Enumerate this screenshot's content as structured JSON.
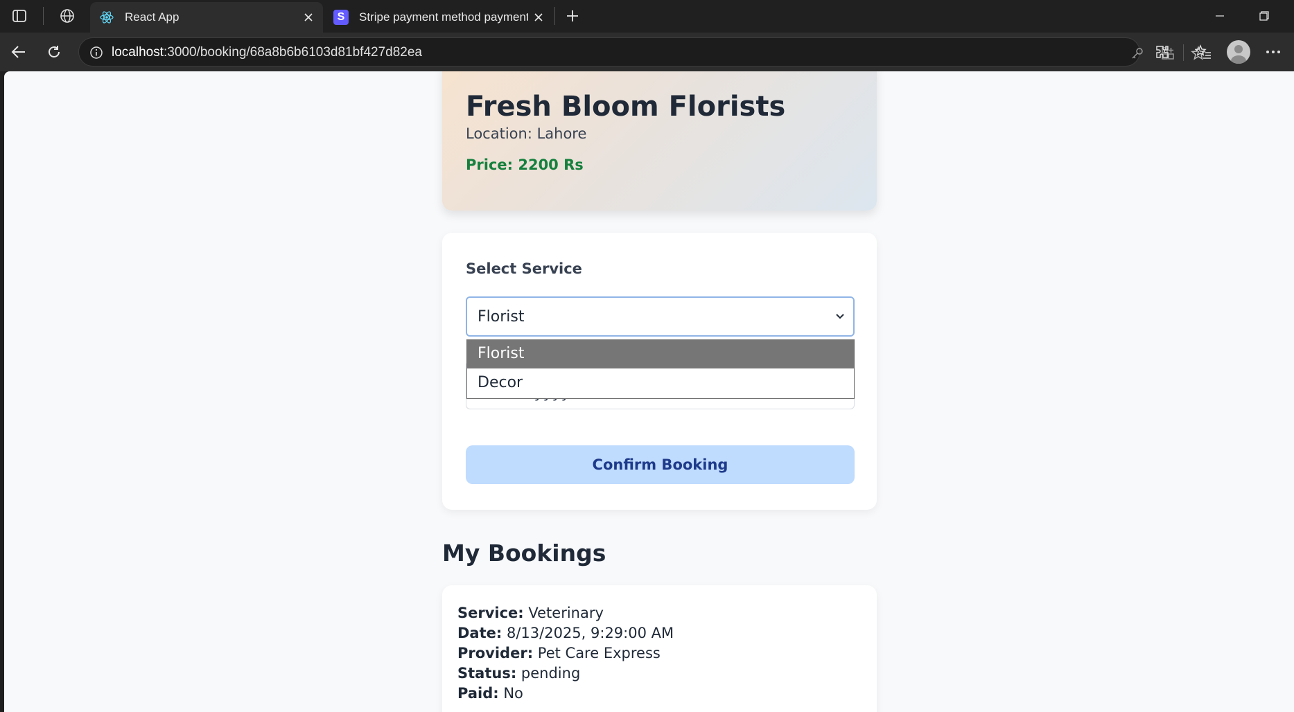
{
  "browser": {
    "tabs": [
      {
        "title": "React App",
        "active": true,
        "favicon": "react-icon"
      },
      {
        "title": "Stripe payment method payment",
        "active": false,
        "favicon": "stripe-icon",
        "favicon_letter": "S"
      }
    ],
    "address": {
      "host": "localhost",
      "path": ":3000/booking/68a8b6b6103d81bf427d82ea"
    }
  },
  "provider": {
    "name": "Fresh Bloom Florists",
    "location": "Location: Lahore",
    "price": "Price: 2200 Rs"
  },
  "form": {
    "select_label": "Select Service",
    "selected_service": "Florist",
    "options": [
      "Florist",
      "Decor"
    ],
    "datetime_placeholder": "mm/dd/yyyy  --:-- --",
    "confirm_label": "Confirm Booking"
  },
  "bookings_section": {
    "title": "My Bookings",
    "items": [
      {
        "service_label": "Service:",
        "service": "Veterinary",
        "date_label": "Date:",
        "date": "8/13/2025, 9:29:00 AM",
        "provider_label": "Provider:",
        "provider": "Pet Care Express",
        "status_label": "Status:",
        "status": "pending",
        "paid_label": "Paid:",
        "paid": "No"
      }
    ]
  },
  "colors": {
    "accent_price": "#15803d",
    "button_bg": "#bfdbfe",
    "button_text": "#1e3a8a",
    "select_focus_border": "#8fb4e6"
  }
}
